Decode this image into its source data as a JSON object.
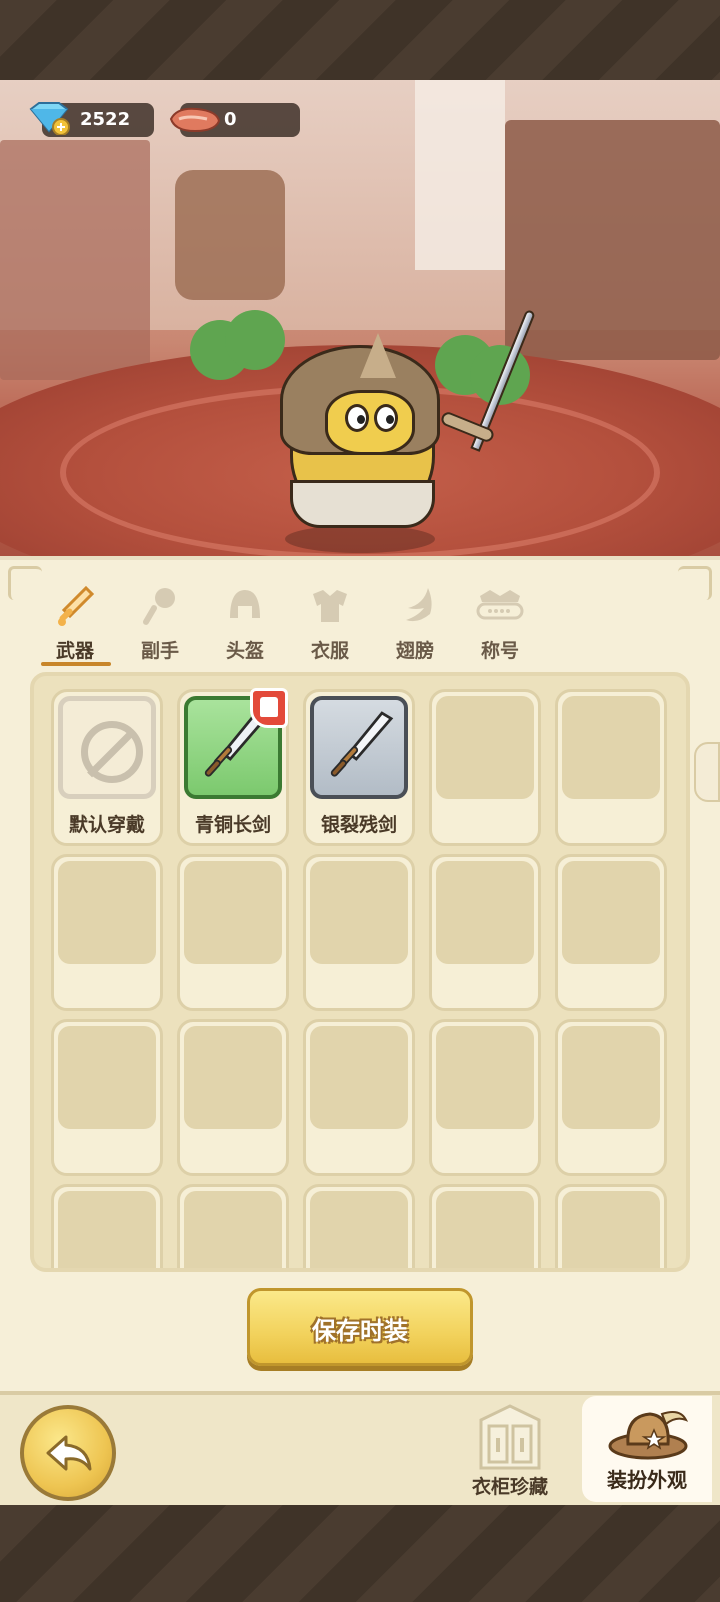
{
  "currency": {
    "gems": "2522",
    "meat": "0"
  },
  "tabs": [
    {
      "label": "武器",
      "icon": "sword-icon",
      "active": true
    },
    {
      "label": "副手",
      "icon": "offhand-icon",
      "active": false
    },
    {
      "label": "头盔",
      "icon": "helmet-icon",
      "active": false
    },
    {
      "label": "衣服",
      "icon": "armor-icon",
      "active": false
    },
    {
      "label": "翅膀",
      "icon": "wing-icon",
      "active": false
    },
    {
      "label": "称号",
      "icon": "title-icon",
      "active": false
    }
  ],
  "items": [
    {
      "label": "默认穿戴",
      "icon": "ban-icon",
      "rarity": "default"
    },
    {
      "label": "青铜长剑",
      "icon": "sword-icon",
      "rarity": "green",
      "badge": "equipped-shirt-icon"
    },
    {
      "label": "银裂残剑",
      "icon": "sword-icon",
      "rarity": "grey"
    }
  ],
  "buttons": {
    "save": "保存时装",
    "wardrobe": "衣柜珍藏",
    "dressup": "装扮外观"
  },
  "colors": {
    "accent": "#c8862a",
    "panel": "#f6efd8",
    "save_button": "#f2d25c"
  }
}
